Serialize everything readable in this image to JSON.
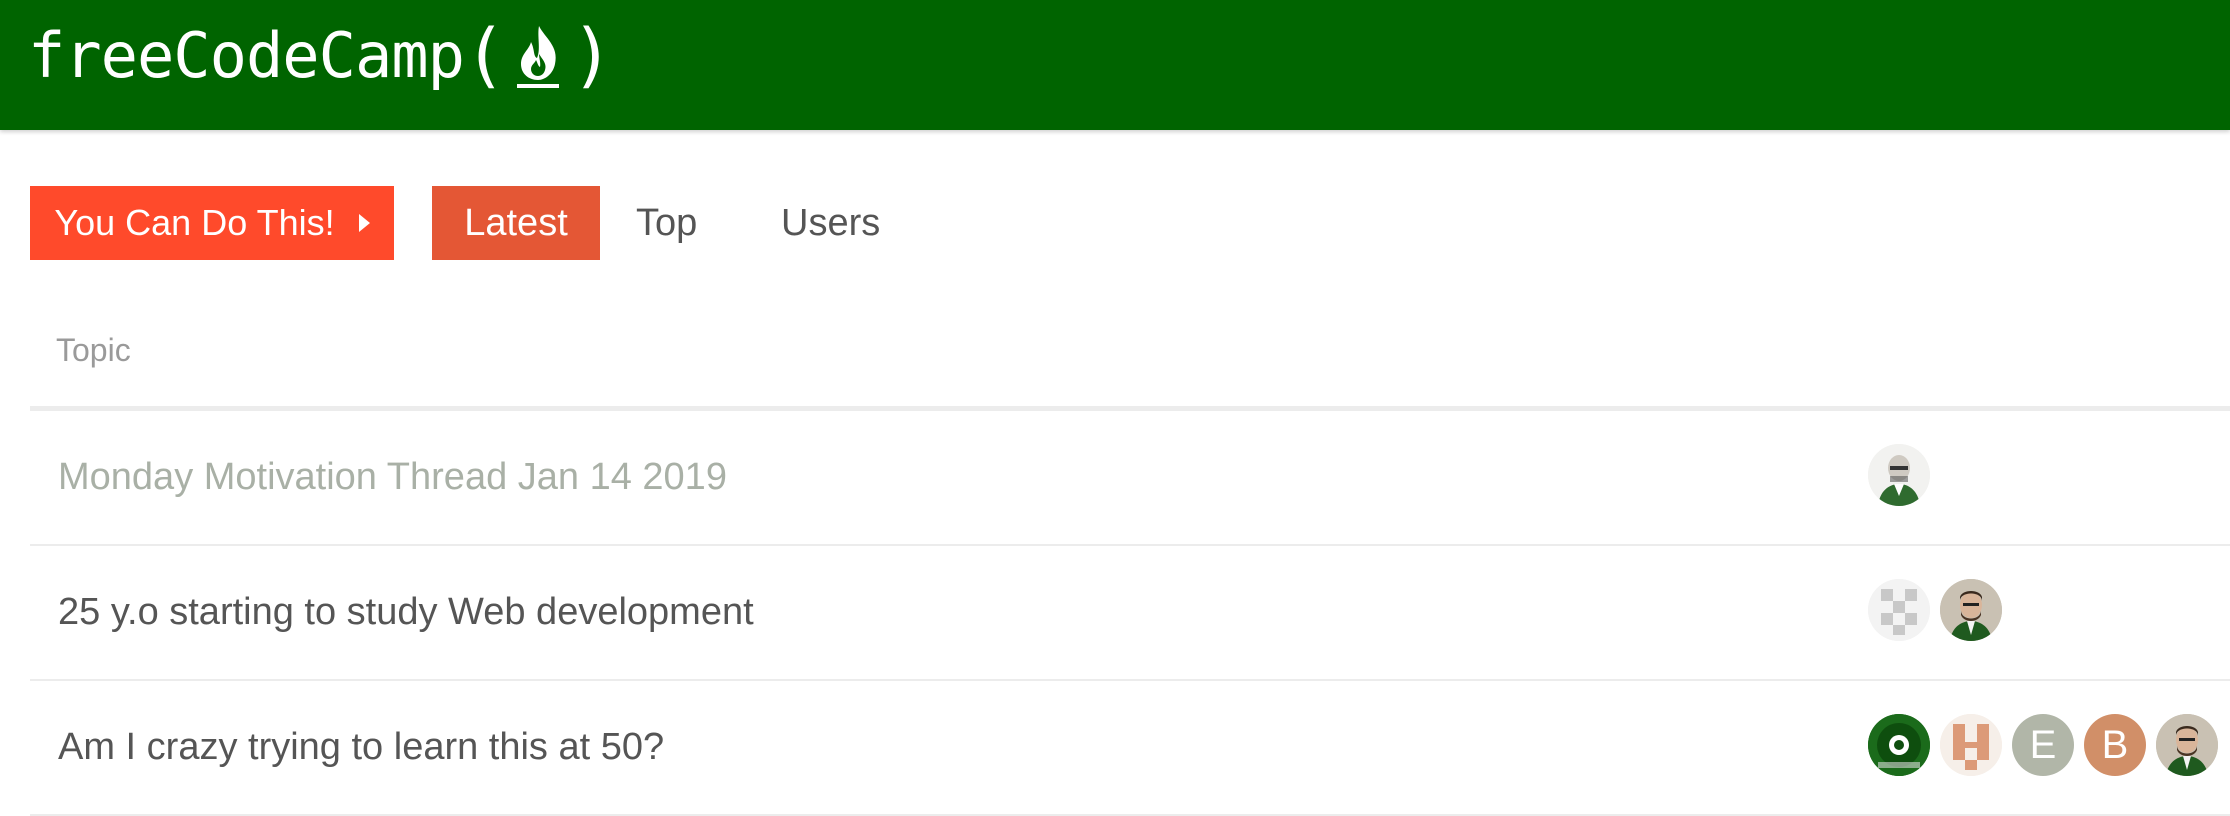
{
  "brand": {
    "name": "freeCodeCamp",
    "open_paren": "(",
    "close_paren": ")",
    "header_color": "#006400"
  },
  "nav": {
    "motivate_label": "You Can Do This!",
    "tabs": [
      {
        "label": "Latest",
        "active": true
      },
      {
        "label": "Top",
        "active": false
      },
      {
        "label": "Users",
        "active": false
      }
    ]
  },
  "topic_list": {
    "header": "Topic",
    "rows": [
      {
        "title": "Monday Motivation Thread Jan 14 2019",
        "visited": true,
        "avatars": [
          {
            "type": "photo-bw"
          }
        ]
      },
      {
        "title": "25 y.o starting to study Web development",
        "visited": false,
        "avatars": [
          {
            "type": "pixel-gray"
          },
          {
            "type": "photo-color"
          }
        ]
      },
      {
        "title": "Am I crazy trying to learn this at 50?",
        "visited": false,
        "avatars": [
          {
            "type": "green-ring"
          },
          {
            "type": "pixel-orange"
          },
          {
            "type": "letter",
            "letter": "E",
            "color": "#b1b6a8"
          },
          {
            "type": "letter",
            "letter": "B",
            "color": "#d18f68"
          },
          {
            "type": "photo-color"
          }
        ]
      }
    ]
  }
}
